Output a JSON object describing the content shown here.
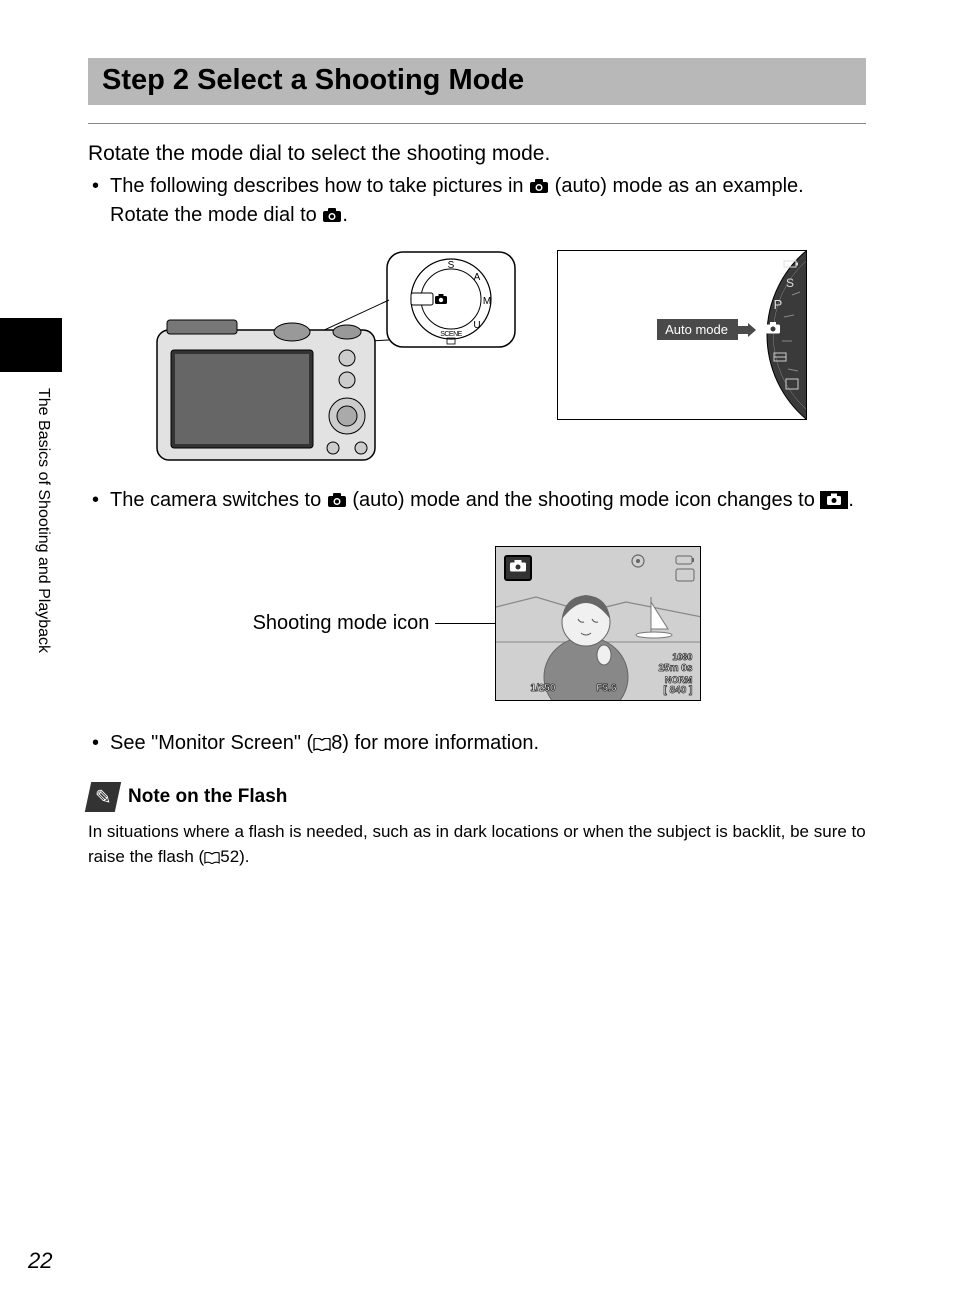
{
  "heading": "Step 2 Select a Shooting Mode",
  "instruction": "Rotate the mode dial to select the shooting mode.",
  "bullets": {
    "b1a": "The following describes how to take pictures in ",
    "b1b": " (auto) mode as an example. Rotate the mode dial to ",
    "b1c": ".",
    "b2a": "The camera switches to ",
    "b2b": " (auto) mode and the shooting mode icon changes to ",
    "b2c": ".",
    "b3a": "See \"Monitor Screen\" (",
    "b3b": "8) for more information."
  },
  "auto_mode_label": "Auto mode",
  "shooting_mode_icon_label": "Shooting mode icon",
  "screen": {
    "shutter": "1/250",
    "aperture": "F5.6",
    "time": "25m 0s",
    "quality": "NORM",
    "count": "840",
    "video": "1080"
  },
  "dial_letters": {
    "s": "S",
    "p": "P",
    "a": "A",
    "m": "M",
    "scene": "SCENE",
    "u": "U"
  },
  "note": {
    "title": "Note on the Flash",
    "body_a": "In situations where a flash is needed, such as in dark locations or when the subject is backlit, be sure to raise the flash (",
    "body_b": "52)."
  },
  "side_tab": "The Basics of Shooting and Playback",
  "page_number": "22"
}
